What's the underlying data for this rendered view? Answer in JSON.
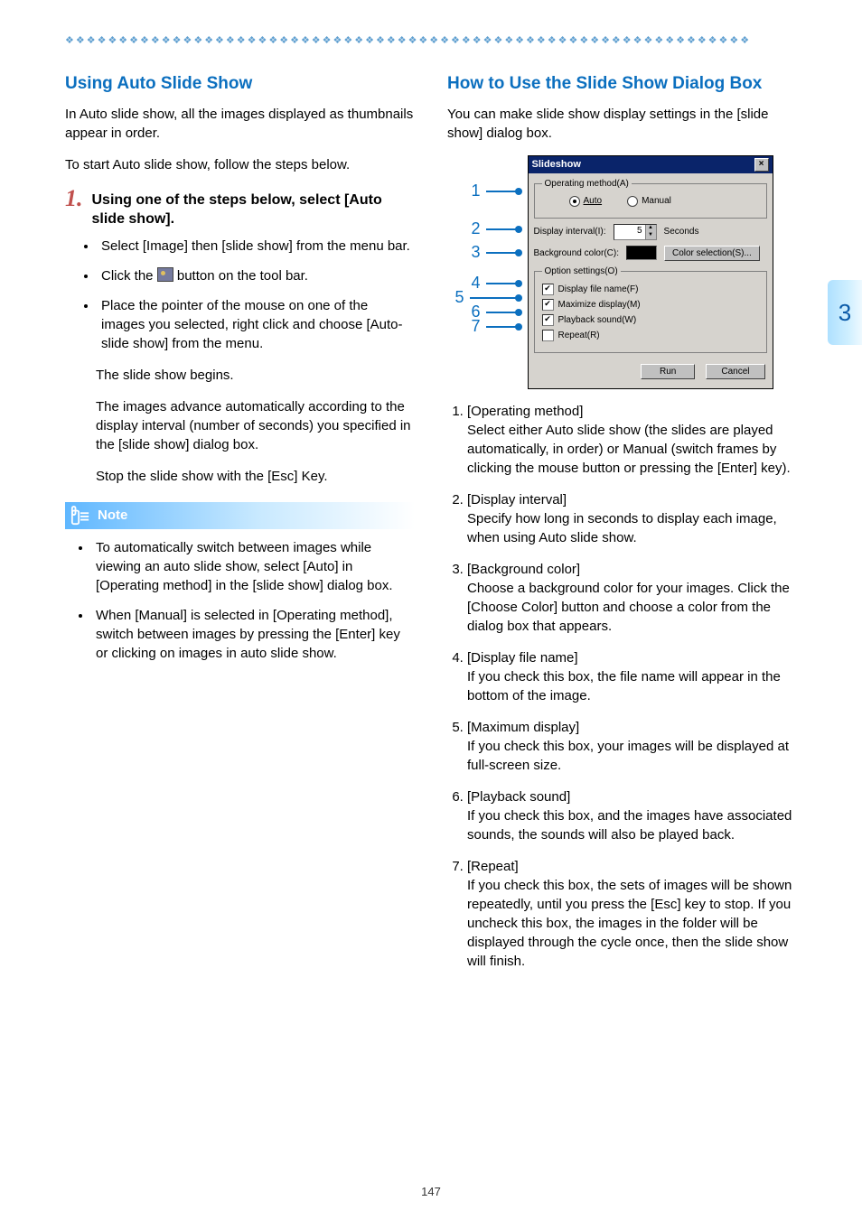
{
  "page_number": "147",
  "side_tab": "3",
  "left": {
    "heading": "Using Auto Slide Show",
    "intro1": "In Auto slide show, all the images displayed as thumbnails appear in order.",
    "intro2": "To start Auto slide show, follow the steps below.",
    "step_num": "1.",
    "step_text": "Using one of the steps below, select [Auto slide show].",
    "bullets": {
      "b1": "Select [Image] then  [slide show] from the menu bar.",
      "b2a": "Click the ",
      "b2b": " button on the tool bar.",
      "b3": "Place the pointer of the mouse on one of the images you selected, right click and choose [Auto-slide show] from the menu."
    },
    "after1": "The slide show begins.",
    "after2": "The images advance automatically according to the display interval (number of seconds) you specified in the [slide show] dialog box.",
    "after3": "Stop the slide show with the [Esc] Key.",
    "note_label": "Note",
    "note_bullets": {
      "n1": "To automatically switch between images while viewing an auto slide show, select [Auto] in [Operating method] in the [slide show] dialog box.",
      "n2": "When [Manual] is selected in [Operating method], switch between images by pressing the [Enter] key or clicking on images in auto slide show."
    }
  },
  "right": {
    "heading": "How to Use the Slide Show Dialog Box",
    "intro": "You can make slide show display settings in the [slide show] dialog box.",
    "dialog": {
      "title": "Slideshow",
      "group_operating": "Operating method(A)",
      "radio_auto": "Auto",
      "radio_manual": "Manual",
      "display_interval_label": "Display interval(I):",
      "interval_value": "5",
      "seconds": "Seconds",
      "bgcolor_label": "Background color(C):",
      "color_select_btn": "Color selection(S)...",
      "group_options": "Option settings(O)",
      "chk_filename": "Display file name(F)",
      "chk_maximize": "Maximize display(M)",
      "chk_playback": "Playback sound(W)",
      "chk_repeat": "Repeat(R)",
      "run_btn": "Run",
      "cancel_btn": "Cancel"
    },
    "callouts": [
      "1",
      "2",
      "3",
      "4",
      "5",
      "6",
      "7"
    ],
    "list": [
      {
        "title": "[Operating method]",
        "body": "Select either Auto slide show (the slides are played automatically, in order) or Manual (switch frames by clicking the mouse button or pressing the [Enter] key)."
      },
      {
        "title": "[Display interval]",
        "body": "Specify how long in seconds to display each image, when using Auto slide show."
      },
      {
        "title": "[Background color]",
        "body": "Choose a background color for your images. Click the [Choose Color] button and choose a color from the dialog box that appears."
      },
      {
        "title": "[Display file name]",
        "body": "If you check this box, the file name will appear in the bottom of the image."
      },
      {
        "title": "[Maximum display]",
        "body": "If you check this box, your images will be displayed at full-screen size."
      },
      {
        "title": "[Playback sound]",
        "body": "If you check this box, and the images have associated sounds, the sounds will also be played back."
      },
      {
        "title": "[Repeat]",
        "body": "If you check this box, the sets of images will be shown repeatedly, until you press the [Esc] key to stop. If you uncheck this box, the images in the folder will be displayed through the cycle once, then the slide show will finish."
      }
    ]
  }
}
